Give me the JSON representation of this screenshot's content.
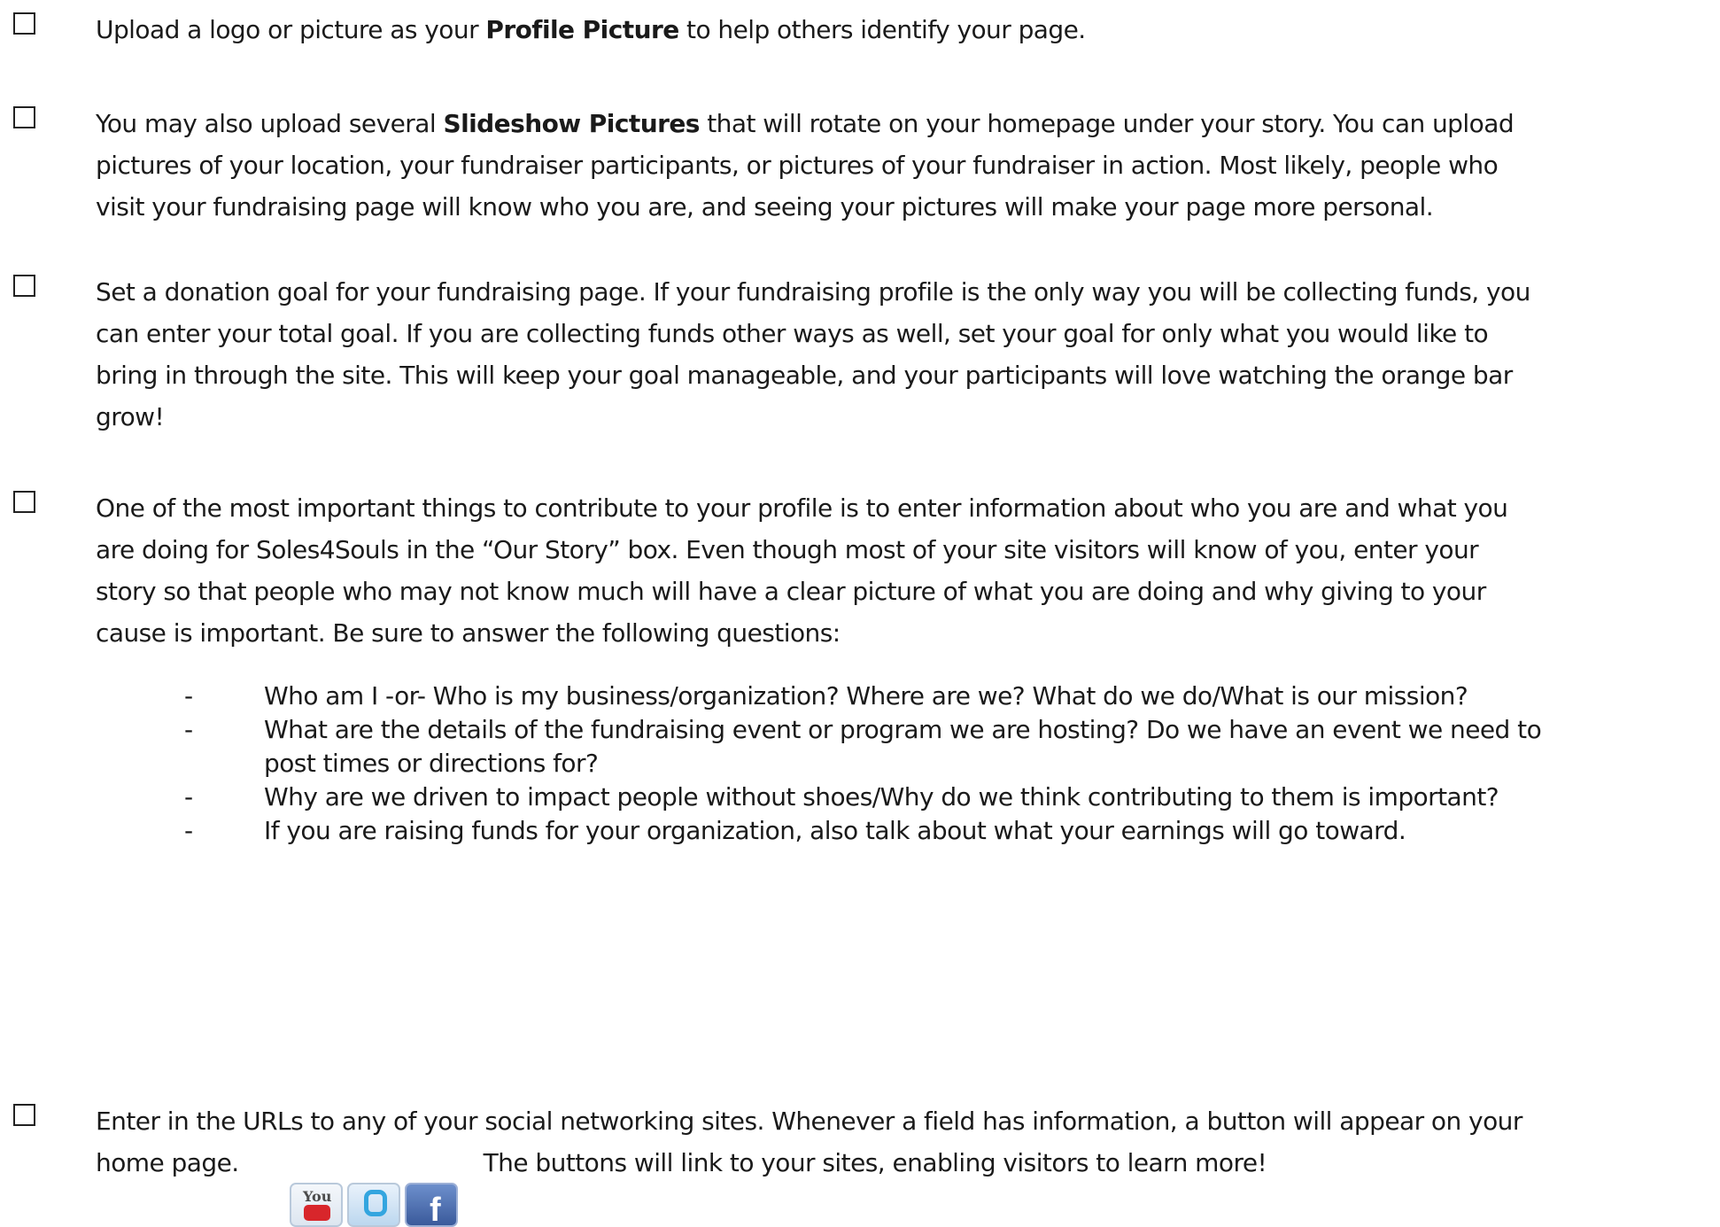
{
  "items": [
    {
      "lines": [
        [
          "Upload a logo or picture as your ",
          {
            "b": "Profile Picture"
          },
          " to help others identify your page."
        ]
      ]
    },
    {
      "lines": [
        [
          "You may also upload several ",
          {
            "b": "Slideshow Pictures"
          },
          " that will rotate on your homepage under your story.  You can upload"
        ],
        [
          "pictures of your location, your fundraiser participants, or pictures of your fundraiser in action.  Most likely, people who"
        ],
        [
          "visit your fundraising page will know who you are, and seeing your pictures will make your page more personal."
        ]
      ]
    },
    {
      "lines": [
        [
          "Set a donation goal for your fundraising page.  If your fundraising profile is the only way you will be collecting funds, you"
        ],
        [
          "can enter your total goal.  If you are collecting funds other ways as well, set your goal for only what you would like to"
        ],
        [
          "bring in through the site.  This will keep your goal manageable, and your participants will love watching the orange bar"
        ],
        [
          "grow!"
        ]
      ]
    },
    {
      "lines": [
        [
          "One of the most important things to contribute to your profile is to enter information about who you are and what you"
        ],
        [
          "are doing for Soles4Souls in the “Our Story” box.  Even though most of your site visitors will know of you, enter your"
        ],
        [
          "story so that people who may not know much will have a clear picture of what you are doing and why giving to your"
        ],
        [
          "cause is important.  Be sure to answer the following questions:"
        ]
      ],
      "bullets": [
        [
          "Who am I -or- Who is my business/organization?  Where are we?  What do we do/What is our mission?"
        ],
        [
          "What are the details of the fundraising event or program we are hosting? Do we have an event we need to",
          "post times or directions for?"
        ],
        [
          "Why are we driven to impact people without shoes/Why do we think contributing to them is important?"
        ],
        [
          "If you are raising funds for your organization, also talk about what your earnings will go toward."
        ]
      ]
    },
    {
      "lines": [
        [
          "Enter in the URLs to any of your social networking sites.  Whenever a field has information, a button will appear on your"
        ],
        [
          "home page.",
          {
            "gap": true
          },
          "The buttons will link to your sites, enabling visitors to learn more!"
        ]
      ]
    }
  ],
  "social_icons": [
    {
      "name": "youtube-icon",
      "label": "You"
    },
    {
      "name": "twitter-icon",
      "label": ""
    },
    {
      "name": "facebook-icon",
      "label": "f"
    }
  ]
}
